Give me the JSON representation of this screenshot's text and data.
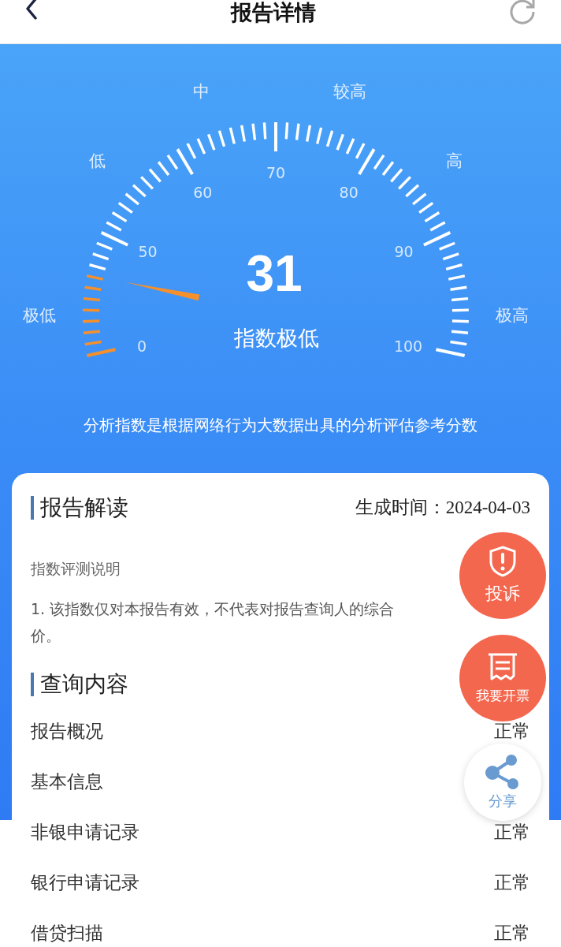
{
  "header": {
    "title": "报告详情"
  },
  "gauge": {
    "score": "31",
    "verdict": "指数极低",
    "level": 0.12,
    "scale_labels": [
      "0",
      "50",
      "60",
      "70",
      "80",
      "90",
      "100"
    ],
    "band_labels": [
      "极低",
      "低",
      "中",
      "较高",
      "高",
      "极高"
    ]
  },
  "caption": "分析指数是根据网络行为大数据出具的分析评估参考分数",
  "report": {
    "title": "报告解读",
    "time_label": "生成时间：",
    "time_value": "2024-04-03",
    "note_title": "指数评测说明",
    "note_lines": [
      "1. 该指数仅对本报告有效，不代表对报告查询人的综合",
      "价。"
    ]
  },
  "query": {
    "title": "查询内容",
    "rows": [
      {
        "label": "报告概况",
        "value": "正常"
      },
      {
        "label": "基本信息"
      },
      {
        "label": "非银申请记录",
        "value": "正常"
      },
      {
        "label": "银行申请记录",
        "value": "正常"
      },
      {
        "label": "借贷扫描",
        "value": "正常"
      }
    ]
  },
  "floating_buttons": [
    {
      "kind": "complaint",
      "label": "投诉"
    },
    {
      "kind": "invoice",
      "label": "我要开票"
    },
    {
      "kind": "share",
      "label": "分享"
    }
  ]
}
